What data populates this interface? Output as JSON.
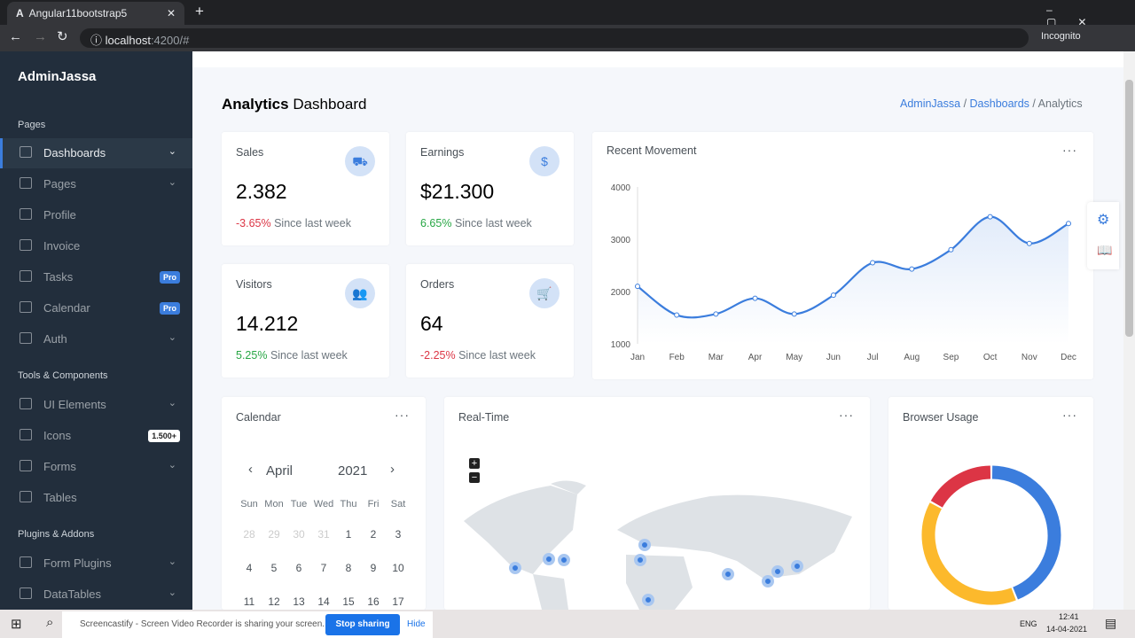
{
  "browser": {
    "tab_title": "Angular11bootstrap5",
    "url_host": "localhost",
    "url_rest": ":4200/#",
    "profile": "Incognito"
  },
  "sidebar": {
    "brand": "AdminJassa",
    "sections": [
      "Pages",
      "Tools & Components",
      "Plugins & Addons"
    ],
    "items": [
      {
        "label": "Dashboards",
        "chevron": true
      },
      {
        "label": "Pages",
        "chevron": true
      },
      {
        "label": "Profile"
      },
      {
        "label": "Invoice"
      },
      {
        "label": "Tasks",
        "badge": "Pro"
      },
      {
        "label": "Calendar",
        "badge": "Pro"
      },
      {
        "label": "Auth",
        "chevron": true
      },
      {
        "label": "UI Elements",
        "chevron": true
      },
      {
        "label": "Icons",
        "badge": "1.500+"
      },
      {
        "label": "Forms",
        "chevron": true
      },
      {
        "label": "Tables"
      },
      {
        "label": "Form Plugins",
        "chevron": true
      },
      {
        "label": "DataTables",
        "chevron": true
      }
    ]
  },
  "header": {
    "title_bold": "Analytics",
    "title_rest": "Dashboard",
    "breadcrumb": [
      "AdminJassa",
      "Dashboards",
      "Analytics"
    ]
  },
  "stats": [
    {
      "title": "Sales",
      "value": "2.382",
      "change": "-3.65%",
      "since": "Since last week",
      "icon": "truck-icon"
    },
    {
      "title": "Earnings",
      "value": "$21.300",
      "change": "6.65%",
      "since": "Since last week",
      "icon": "dollar-icon"
    },
    {
      "title": "Visitors",
      "value": "14.212",
      "change": "5.25%",
      "since": "Since last week",
      "icon": "users-icon"
    },
    {
      "title": "Orders",
      "value": "64",
      "change": "-2.25%",
      "since": "Since last week",
      "icon": "cart-icon"
    }
  ],
  "chart_data": [
    {
      "type": "area",
      "title": "Recent Movement",
      "categories": [
        "Jan",
        "Feb",
        "Mar",
        "Apr",
        "May",
        "Jun",
        "Jul",
        "Aug",
        "Sep",
        "Oct",
        "Nov",
        "Dec"
      ],
      "values": [
        2100,
        1550,
        1570,
        1870,
        1570,
        1930,
        2550,
        2430,
        2800,
        3430,
        2920,
        3300
      ],
      "yticks": [
        "1000",
        "2000",
        "3000",
        "4000"
      ],
      "ylim": [
        1000,
        4000
      ],
      "color": "#3b7ddd"
    },
    {
      "type": "pie",
      "title": "Browser Usage",
      "values": [
        44,
        39,
        17
      ],
      "colors": [
        "#3b7ddd",
        "#fcb92c",
        "#dc3545"
      ]
    }
  ],
  "calendar": {
    "title": "Calendar",
    "month": "April",
    "year": "2021",
    "weekdays": [
      "Sun",
      "Mon",
      "Tue",
      "Wed",
      "Thu",
      "Fri",
      "Sat"
    ],
    "weeks": [
      [
        "28",
        "29",
        "30",
        "31",
        "1",
        "2",
        "3"
      ],
      [
        "4",
        "5",
        "6",
        "7",
        "8",
        "9",
        "10"
      ],
      [
        "11",
        "12",
        "13",
        "14",
        "15",
        "16",
        "17"
      ]
    ]
  },
  "realtime": {
    "title": "Real-Time",
    "zoom_in": "+",
    "zoom_out": "−"
  },
  "taskbar": {
    "share_text": "Screencastify - Screen Video Recorder is sharing your screen.",
    "stop": "Stop sharing",
    "hide": "Hide",
    "lang": "ENG",
    "time": "12:41",
    "date": "14-04-2021"
  }
}
